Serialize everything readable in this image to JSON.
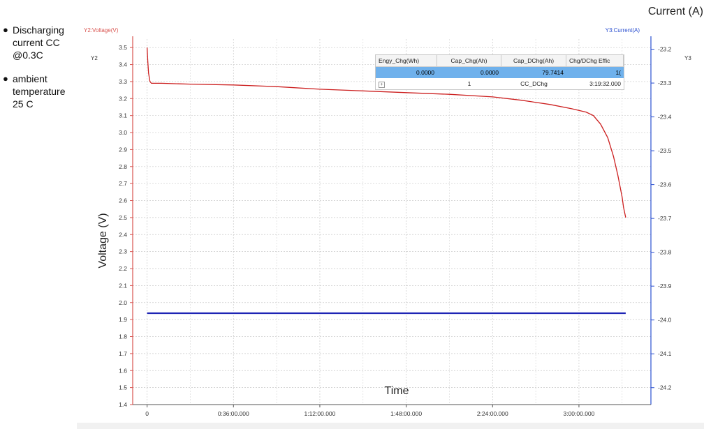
{
  "notes": [
    "Discharging current CC @0.3C",
    "ambient temperature 25 C"
  ],
  "chart_data": {
    "type": "line",
    "title": "",
    "overlay_labels": {
      "top_right": "Current (A)",
      "y_left": "Voltage (V)",
      "x": "Time"
    },
    "left_axis": {
      "header": "Y2:Voltage(V)",
      "tag": "Y2",
      "ylim": [
        1.4,
        3.55
      ],
      "ticks": [
        "1.4",
        "1.5",
        "1.6",
        "1.7",
        "1.8",
        "1.9",
        "2.0",
        "2.1",
        "2.2",
        "2.3",
        "2.4",
        "2.5",
        "2.6",
        "2.7",
        "2.8",
        "2.9",
        "3.0",
        "3.1",
        "3.2",
        "3.3",
        "3.4",
        "3.5"
      ]
    },
    "right_axis": {
      "header": "Y3:Current(A)",
      "tag": "Y3",
      "ylim": [
        -24.25,
        -23.17
      ],
      "ticks": [
        "-23.2",
        "-23.3",
        "-23.4",
        "-23.5",
        "-23.6",
        "-23.7",
        "-23.8",
        "-23.9",
        "-24.0",
        "-24.1",
        "-24.2"
      ]
    },
    "x_axis": {
      "xlim": [
        -0.1,
        3.5
      ],
      "ticks": [
        {
          "v": 0,
          "label": "0"
        },
        {
          "v": 0.6,
          "label": "0:36:00.000"
        },
        {
          "v": 1.2,
          "label": "1:12:00.000"
        },
        {
          "v": 1.8,
          "label": "1:48:00.000"
        },
        {
          "v": 2.4,
          "label": "2:24:00.000"
        },
        {
          "v": 3.0,
          "label": "3:00:00.000"
        }
      ]
    },
    "grid": true,
    "series": [
      {
        "axis": "left",
        "color": "#cc1f1f",
        "x": [
          0,
          0.005,
          0.01,
          0.02,
          0.03,
          0.05,
          0.1,
          0.3,
          0.6,
          0.9,
          1.2,
          1.5,
          1.8,
          2.1,
          2.4,
          2.6,
          2.8,
          2.95,
          3.05,
          3.1,
          3.15,
          3.2,
          3.24,
          3.27,
          3.3,
          3.31,
          3.325
        ],
        "y": [
          3.5,
          3.42,
          3.35,
          3.3,
          3.29,
          3.29,
          3.29,
          3.285,
          3.28,
          3.27,
          3.255,
          3.245,
          3.235,
          3.225,
          3.21,
          3.19,
          3.165,
          3.14,
          3.12,
          3.1,
          3.05,
          2.97,
          2.86,
          2.75,
          2.62,
          2.56,
          2.5
        ]
      },
      {
        "axis": "right",
        "color": "#1e24b4",
        "x": [
          0,
          3.325
        ],
        "y": [
          -23.98,
          -23.98
        ]
      }
    ]
  },
  "table": {
    "headers": [
      "Engy_Chg(Wh)",
      "Cap_Chg(Ah)",
      "Cap_DChg(Ah)",
      "Chg/DChg Effic"
    ],
    "selected_row": [
      "0.0000",
      "0.0000",
      "79.7414",
      "1("
    ],
    "detail_row": {
      "expander": "+",
      "index": "1",
      "step": "CC_DChg",
      "time": "3:19:32.000"
    }
  }
}
